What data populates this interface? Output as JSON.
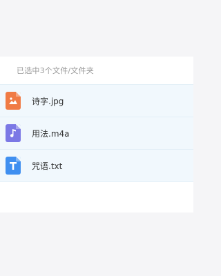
{
  "selection": {
    "summary": "已选中3个文件/文件夹"
  },
  "files": [
    {
      "name": "诗字.jpg",
      "type": "image",
      "icon": "image-file-icon",
      "color": "#f07b45"
    },
    {
      "name": "用法.m4a",
      "type": "audio",
      "icon": "music-file-icon",
      "color": "#7b78e5"
    },
    {
      "name": "咒语.txt",
      "type": "text",
      "icon": "text-file-icon",
      "color": "#3f8ff0"
    }
  ]
}
